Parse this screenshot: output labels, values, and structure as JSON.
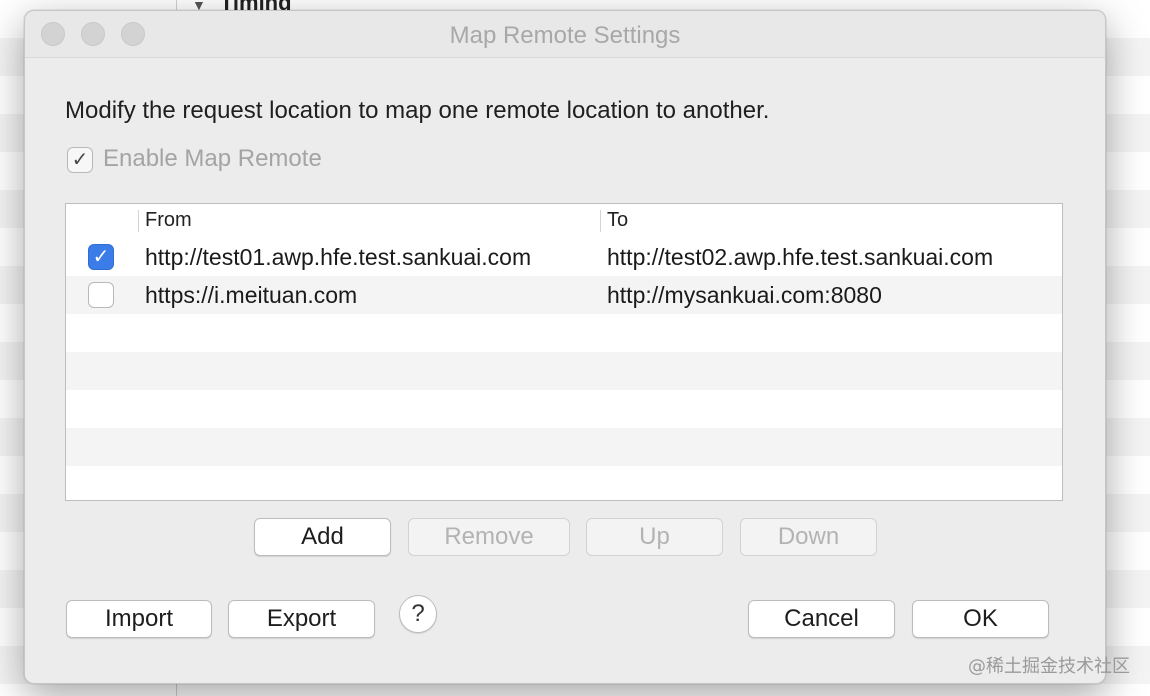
{
  "background": {
    "section_title": "Timing",
    "triangle": "▼"
  },
  "dialog": {
    "title": "Map Remote Settings",
    "description": "Modify the request location to map one remote location to another.",
    "enable": {
      "label": "Enable Map Remote",
      "checked": true,
      "check_glyph": "✓"
    },
    "table": {
      "columns": [
        "From",
        "To"
      ],
      "rows": [
        {
          "enabled": true,
          "from": "http://test01.awp.hfe.test.sankuai.com",
          "to": "http://test02.awp.hfe.test.sankuai.com"
        },
        {
          "enabled": false,
          "from": "https://i.meituan.com",
          "to": "http://mysankuai.com:8080"
        }
      ]
    },
    "buttons": {
      "add": "Add",
      "remove": "Remove",
      "up": "Up",
      "down": "Down",
      "import": "Import",
      "export": "Export",
      "help": "?",
      "cancel": "Cancel",
      "ok": "OK"
    }
  },
  "watermark": "@稀土掘金技术社区",
  "colors": {
    "accent": "#3b7ce8",
    "dialog_bg": "#ececec",
    "disabled_text": "#b3b3b3"
  }
}
